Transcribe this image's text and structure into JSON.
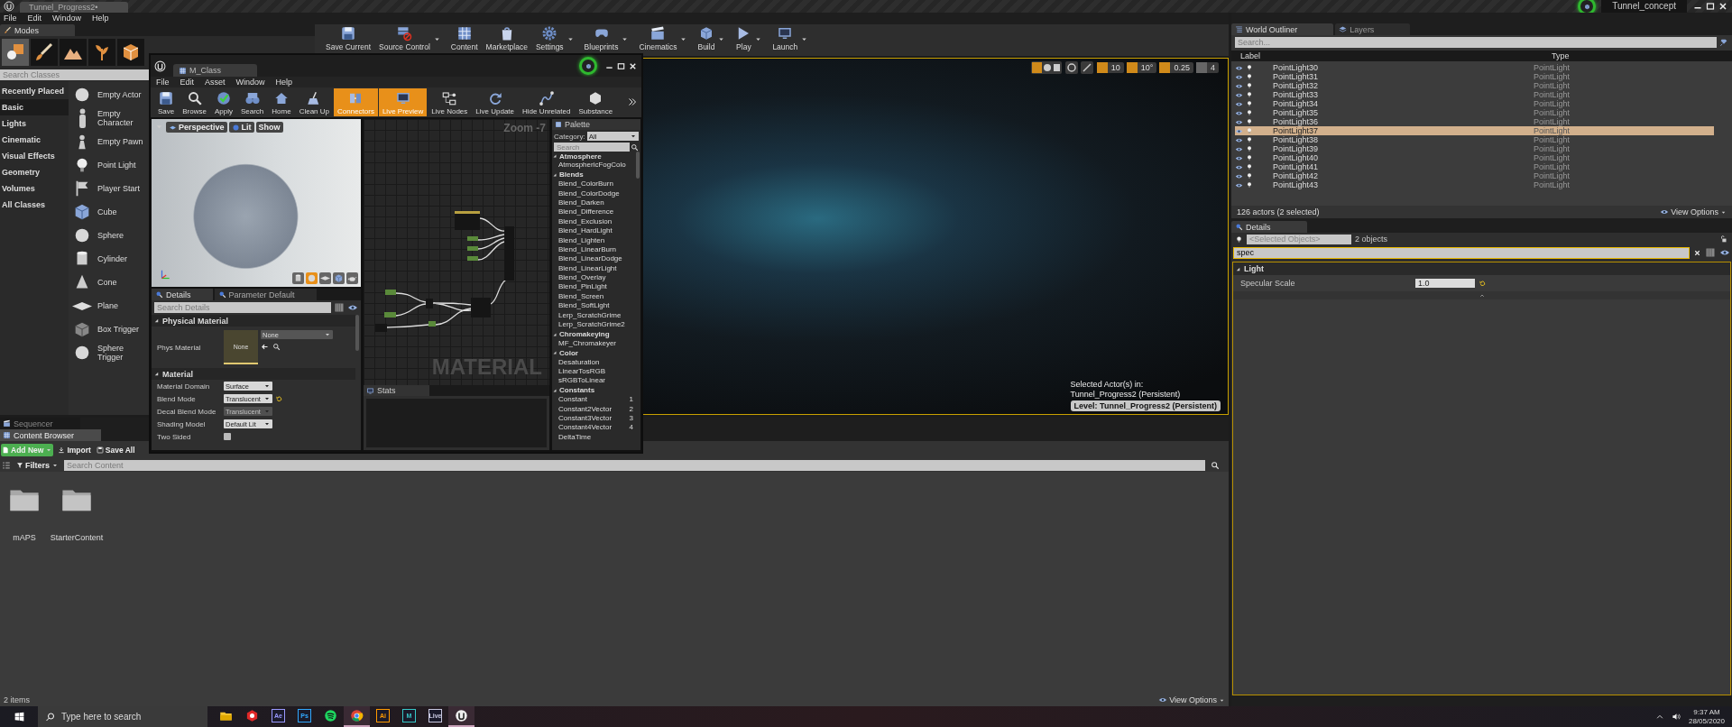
{
  "title_bar": {
    "tab": "Tunnel_Progress2•",
    "project": "Tunnel_concept"
  },
  "menu": [
    "File",
    "Edit",
    "Window",
    "Help"
  ],
  "modes": {
    "tab": "Modes",
    "tools": [
      {
        "kind": "place",
        "selected": true
      },
      {
        "kind": "paint",
        "selected": false
      },
      {
        "kind": "landscape",
        "selected": false
      },
      {
        "kind": "foliage",
        "selected": false
      },
      {
        "kind": "geometry",
        "selected": false
      }
    ],
    "search": {
      "placeholder": "Search Classes"
    },
    "categories": [
      {
        "label": "Recently Placed",
        "selected": false
      },
      {
        "label": "Basic",
        "selected": true
      },
      {
        "label": "Lights",
        "selected": false
      },
      {
        "label": "Cinematic",
        "selected": false
      },
      {
        "label": "Visual Effects",
        "selected": false
      },
      {
        "label": "Geometry",
        "selected": false
      },
      {
        "label": "Volumes",
        "selected": false
      },
      {
        "label": "All Classes",
        "selected": false
      }
    ],
    "items": [
      {
        "label": "Empty Actor",
        "kind": "sphere"
      },
      {
        "label": "Empty Character",
        "kind": "figure"
      },
      {
        "label": "Empty Pawn",
        "kind": "pawn"
      },
      {
        "label": "Point Light",
        "kind": "bulb"
      },
      {
        "label": "Player Start",
        "kind": "flag"
      },
      {
        "label": "Cube",
        "kind": "cube"
      },
      {
        "label": "Sphere",
        "kind": "sphere"
      },
      {
        "label": "Cylinder",
        "kind": "cylinder"
      },
      {
        "label": "Cone",
        "kind": "cone"
      },
      {
        "label": "Plane",
        "kind": "plane"
      },
      {
        "label": "Box Trigger",
        "kind": "box"
      },
      {
        "label": "Sphere Trigger",
        "kind": "sphere"
      }
    ]
  },
  "toolbar": [
    {
      "label": "Save Current",
      "kind": "floppy",
      "dropdown": false
    },
    {
      "label": "Source Control",
      "kind": "server",
      "dropdown": true
    },
    {
      "label": "Content",
      "kind": "grid",
      "dropdown": false
    },
    {
      "label": "Marketplace",
      "kind": "bag",
      "dropdown": false
    },
    {
      "label": "Settings",
      "kind": "gear",
      "dropdown": true
    },
    {
      "label": "Blueprints",
      "kind": "gamepad",
      "dropdown": true
    },
    {
      "label": "Cinematics",
      "kind": "clapper",
      "dropdown": true
    },
    {
      "label": "Build",
      "kind": "cube",
      "dropdown": true
    },
    {
      "label": "Play",
      "kind": "play",
      "dropdown": true
    },
    {
      "label": "Launch",
      "kind": "monitor",
      "dropdown": true
    }
  ],
  "viewport": {
    "snaps": [
      {
        "label": "10",
        "active": true
      },
      {
        "label": "10°",
        "active": true
      },
      {
        "label": "0.25",
        "active": true
      },
      {
        "label": "4",
        "active": false
      }
    ],
    "selection_info": [
      "Selected Actor(s) in:",
      "Tunnel_Progress2 (Persistent)"
    ],
    "level": "Level:  Tunnel_Progress2 (Persistent)"
  },
  "material_editor": {
    "tab": "M_Class",
    "menu": [
      "File",
      "Edit",
      "Asset",
      "Window",
      "Help"
    ],
    "toolbar": [
      {
        "label": "Save",
        "kind": "floppy",
        "active": false
      },
      {
        "label": "Browse",
        "kind": "search",
        "active": false
      },
      {
        "label": "Apply",
        "kind": "check",
        "active": false
      },
      {
        "label": "Search",
        "kind": "binoculars",
        "active": false
      },
      {
        "label": "Home",
        "kind": "house",
        "active": false
      },
      {
        "label": "Clean Up",
        "kind": "broom",
        "active": false
      },
      {
        "label": "Connectors",
        "kind": "plug",
        "active": true
      },
      {
        "label": "Live Preview",
        "kind": "monitor",
        "active": true
      },
      {
        "label": "Live Nodes",
        "kind": "nodes",
        "active": false
      },
      {
        "label": "Live Update",
        "kind": "refresh",
        "active": false
      },
      {
        "label": "Hide Unrelated",
        "kind": "curve",
        "active": false
      },
      {
        "label": "Substance",
        "kind": "hexagon",
        "active": false
      }
    ],
    "preview": {
      "buttons": [
        {
          "label": "Perspective",
          "kind": "camera"
        },
        {
          "label": "Lit",
          "kind": "lit"
        },
        {
          "label": "Show",
          "kind": "plain"
        }
      ],
      "shapes": [
        {
          "kind": "cylinder",
          "selected": false
        },
        {
          "kind": "sphere",
          "selected": true
        },
        {
          "kind": "plane",
          "selected": false
        },
        {
          "kind": "cube",
          "selected": false
        },
        {
          "kind": "teapot",
          "selected": false
        }
      ]
    },
    "graph": {
      "zoom": "Zoom -7",
      "watermark": "MATERIAL"
    },
    "details": {
      "tabs": [
        {
          "label": "Details",
          "selected": true
        },
        {
          "label": "Parameter Default",
          "selected": false
        }
      ],
      "search": {
        "placeholder": "Search Details"
      },
      "sections": [
        {
          "title": "Physical Material",
          "rows": [
            {
              "kind": "asset",
              "label": "Phys Material",
              "thumbnail": "None",
              "value": "None"
            }
          ]
        },
        {
          "title": "Material",
          "rows": [
            {
              "kind": "dropdown",
              "label": "Material Domain",
              "value": "Surface",
              "disabled": false,
              "modified": false
            },
            {
              "kind": "dropdown",
              "label": "Blend Mode",
              "value": "Translucent",
              "disabled": false,
              "modified": true
            },
            {
              "kind": "dropdown",
              "label": "Decal Blend Mode",
              "value": "Translucent",
              "disabled": true,
              "modified": false
            },
            {
              "kind": "dropdown",
              "label": "Shading Model",
              "value": "Default Lit",
              "disabled": false,
              "modified": false
            },
            {
              "kind": "checkbox",
              "label": "Two Sided",
              "checked": false
            }
          ]
        }
      ]
    },
    "stats": {
      "tab": "Stats"
    },
    "palette": {
      "tab": "Palette",
      "category_label": "Category:",
      "category": "All",
      "search": {
        "placeholder": "Search"
      },
      "groups": [
        {
          "label": "Atmosphere",
          "expanded": true,
          "children": [
            {
              "label": "AtmosphericFogColo"
            }
          ]
        },
        {
          "label": "Blends",
          "expanded": true,
          "children": [
            {
              "label": "Blend_ColorBurn"
            },
            {
              "label": "Blend_ColorDodge"
            },
            {
              "label": "Blend_Darken"
            },
            {
              "label": "Blend_Difference"
            },
            {
              "label": "Blend_Exclusion"
            },
            {
              "label": "Blend_HardLight"
            },
            {
              "label": "Blend_Lighten"
            },
            {
              "label": "Blend_LinearBurn"
            },
            {
              "label": "Blend_LinearDodge"
            },
            {
              "label": "Blend_LinearLight"
            },
            {
              "label": "Blend_Overlay"
            },
            {
              "label": "Blend_PinLight"
            },
            {
              "label": "Blend_Screen"
            },
            {
              "label": "Blend_SoftLight"
            },
            {
              "label": "Lerp_ScratchGrime"
            },
            {
              "label": "Lerp_ScratchGrime2"
            }
          ]
        },
        {
          "label": "Chromakeying",
          "expanded": true,
          "children": [
            {
              "label": "MF_Chromakeyer"
            }
          ]
        },
        {
          "label": "Color",
          "expanded": true,
          "children": [
            {
              "label": "Desaturation"
            },
            {
              "label": "LinearTosRGB"
            },
            {
              "label": "sRGBToLinear"
            }
          ]
        },
        {
          "label": "Constants",
          "expanded": true,
          "children": [
            {
              "label": "Constant",
              "hotkey": "1"
            },
            {
              "label": "Constant2Vector",
              "hotkey": "2"
            },
            {
              "label": "Constant3Vector",
              "hotkey": "3"
            },
            {
              "label": "Constant4Vector",
              "hotkey": "4"
            },
            {
              "label": "DeltaTime"
            }
          ]
        }
      ]
    }
  },
  "outliner": {
    "tabs": [
      {
        "label": "World Outliner",
        "selected": true
      },
      {
        "label": "Layers",
        "selected": false
      }
    ],
    "search": {
      "placeholder": "Search..."
    },
    "columns": [
      "Label",
      "Type"
    ],
    "rows": [
      {
        "label": "PointLight30",
        "type": "PointLight",
        "selected": false
      },
      {
        "label": "PointLight31",
        "type": "PointLight",
        "selected": false
      },
      {
        "label": "PointLight32",
        "type": "PointLight",
        "selected": false
      },
      {
        "label": "PointLight33",
        "type": "PointLight",
        "selected": false
      },
      {
        "label": "PointLight34",
        "type": "PointLight",
        "selected": false
      },
      {
        "label": "PointLight35",
        "type": "PointLight",
        "selected": false
      },
      {
        "label": "PointLight36",
        "type": "PointLight",
        "selected": false
      },
      {
        "label": "PointLight37",
        "type": "PointLight",
        "selected": true
      },
      {
        "label": "PointLight38",
        "type": "PointLight",
        "selected": false
      },
      {
        "label": "PointLight39",
        "type": "PointLight",
        "selected": false
      },
      {
        "label": "PointLight40",
        "type": "PointLight",
        "selected": false
      },
      {
        "label": "PointLight41",
        "type": "PointLight",
        "selected": false
      },
      {
        "label": "PointLight42",
        "type": "PointLight",
        "selected": false
      },
      {
        "label": "PointLight43",
        "type": "PointLight",
        "selected": false
      }
    ],
    "status": "126 actors (2 selected)",
    "view_options": "View Options"
  },
  "details": {
    "tab": "Details",
    "selection": "<Selected Objects>",
    "count": "2 objects",
    "search": {
      "value": "spec"
    },
    "sections": [
      {
        "title": "Light",
        "rows": [
          {
            "label": "Specular Scale",
            "value": "1.0"
          }
        ]
      }
    ]
  },
  "content_browser": {
    "tabs": [
      {
        "label": "Sequencer",
        "selected": false
      },
      {
        "label": "Content Browser",
        "selected": true
      }
    ],
    "buttons": [
      {
        "label": "Add New",
        "kind": "add"
      },
      {
        "label": "Import",
        "kind": "import"
      },
      {
        "label": "Save All",
        "kind": "save"
      }
    ],
    "filters": "Filters",
    "search": {
      "placeholder": "Search Content"
    },
    "folders": [
      "mAPS",
      "StarterContent"
    ],
    "status": "2 items",
    "view_options": "View Options"
  },
  "taskbar": {
    "search": {
      "placeholder": "Type here to search"
    },
    "apps": [
      {
        "kind": "explorer",
        "running": false
      },
      {
        "kind": "substance",
        "running": false
      },
      {
        "kind": "badge",
        "label": "Ae",
        "color": "#9999ff",
        "running": false
      },
      {
        "kind": "badge",
        "label": "Ps",
        "color": "#31a8ff",
        "running": false
      },
      {
        "kind": "spotify",
        "running": false
      },
      {
        "kind": "chrome",
        "running": true
      },
      {
        "kind": "badge",
        "label": "Ai",
        "color": "#ff9a00",
        "running": false
      },
      {
        "kind": "badge",
        "label": "M",
        "color": "#37c8c8",
        "running": false
      },
      {
        "kind": "badge",
        "label": "Live",
        "color": "#c8c8e0",
        "running": false
      },
      {
        "kind": "unreal",
        "running": true
      }
    ],
    "time": "9:37 AM",
    "date": "28/05/2020"
  }
}
